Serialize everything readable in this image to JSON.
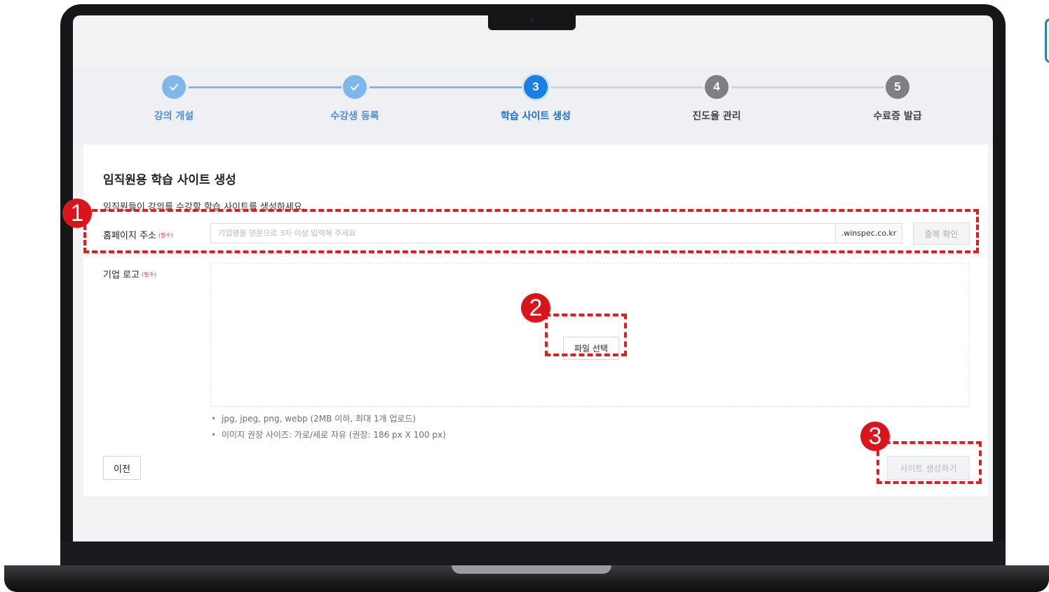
{
  "stepper": {
    "steps": [
      {
        "number": "1",
        "label": "강의 개설",
        "state": "done"
      },
      {
        "number": "2",
        "label": "수강생 등록",
        "state": "done"
      },
      {
        "number": "3",
        "label": "학습 사이트 생성",
        "state": "active"
      },
      {
        "number": "4",
        "label": "진도율 관리",
        "state": "todo"
      },
      {
        "number": "5",
        "label": "수료증 발급",
        "state": "todo"
      }
    ]
  },
  "form": {
    "title": "임직원용 학습 사이트 생성",
    "description": "임직원들이 강의를 수강할 학습 사이트를 생성하세요.",
    "homepage": {
      "label": "홈페이지 주소",
      "required": "(필수)",
      "placeholder": "기업명을 영문으로 3자 이상 입력해 주세요",
      "value": "",
      "suffix": ".winspec.co.kr",
      "check_button": "중복 확인"
    },
    "logo": {
      "label": "기업 로고",
      "required": "(필수)",
      "file_button": "파일 선택",
      "hints": [
        "jpg, jpeg, png, webp (2MB 이하, 최대 1개 업로드)",
        "이미지 권장 사이즈: 가로/세로 자유 (권장: 186 px X 100 px)"
      ]
    },
    "prev_button": "이전",
    "create_button": "사이트 생성하기"
  },
  "annotations": [
    "1",
    "2",
    "3"
  ],
  "colors": {
    "accent": "#1a7fe3",
    "done": "#7fb7ec",
    "todo": "#7d7f84",
    "annotation": "#e11d22"
  }
}
